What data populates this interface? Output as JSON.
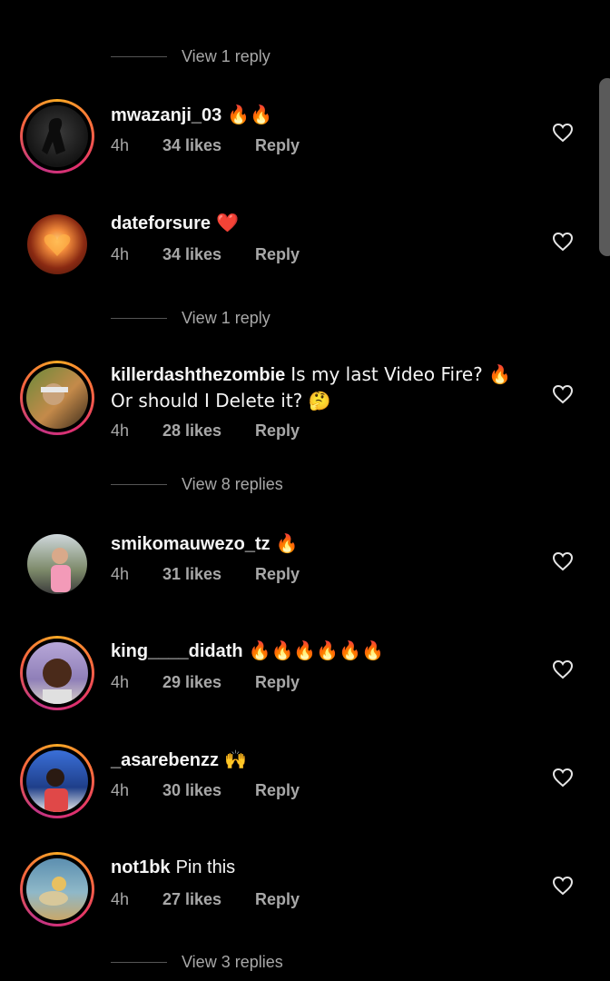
{
  "reply_threads": [
    {
      "label": "View 1 reply"
    },
    {
      "label": "View 1 reply"
    },
    {
      "label": "View 8 replies"
    },
    {
      "label": "View 3 replies"
    }
  ],
  "comments": [
    {
      "username": "mwazanji_03",
      "text": "🔥🔥",
      "time": "4h",
      "likes": "34 likes",
      "reply": "Reply"
    },
    {
      "username": "dateforsure",
      "text": "❤️",
      "time": "4h",
      "likes": "34 likes",
      "reply": "Reply"
    },
    {
      "username": "killerdashthezombie",
      "text": "Is my last Video Fire? 🔥 Or should I Delete it? 🤔",
      "time": "4h",
      "likes": "28 likes",
      "reply": "Reply"
    },
    {
      "username": "smikomauwezo_tz",
      "text": "🔥",
      "time": "4h",
      "likes": "31 likes",
      "reply": "Reply"
    },
    {
      "username": "king____didath",
      "text": "🔥🔥🔥🔥🔥🔥",
      "time": "4h",
      "likes": "29 likes",
      "reply": "Reply"
    },
    {
      "username": "_asarebenzz",
      "text": "🙌",
      "time": "4h",
      "likes": "30 likes",
      "reply": "Reply"
    },
    {
      "username": "not1bk",
      "text": "Pin this",
      "time": "4h",
      "likes": "27 likes",
      "reply": "Reply"
    }
  ],
  "icons": {
    "like": "heart-outline-icon"
  },
  "colors": {
    "background": "#000000",
    "secondary_text": "#a8a8a8",
    "ring": "#e1306c"
  }
}
